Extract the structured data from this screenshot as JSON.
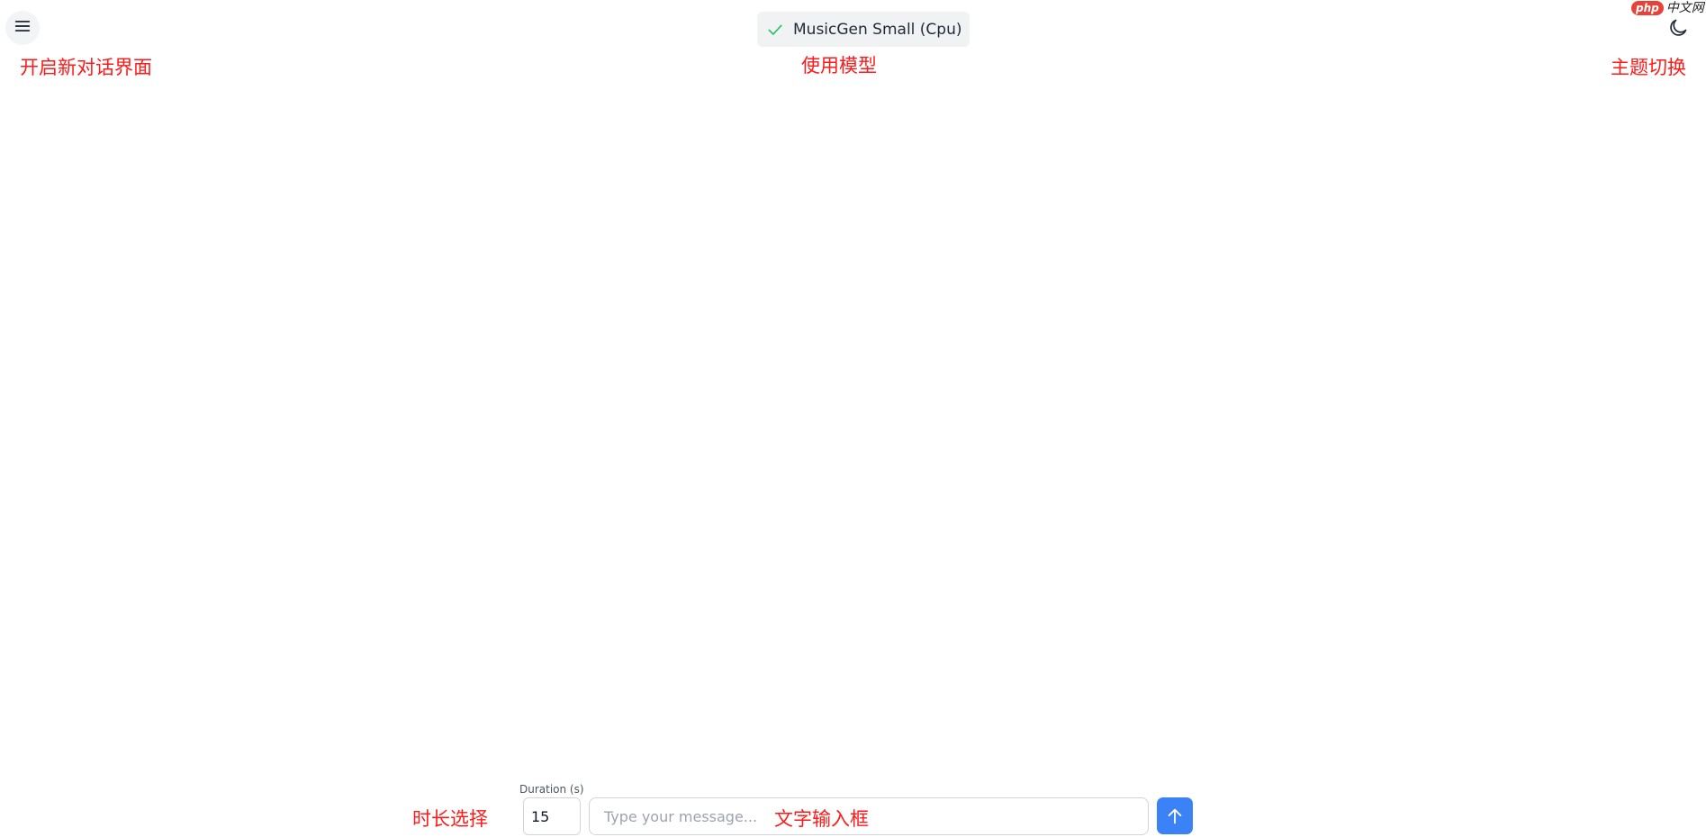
{
  "header": {
    "menu_icon": "hamburger-menu-icon",
    "model_badge": {
      "label": "MusicGen Small (Cpu)",
      "icon": "check-icon",
      "icon_color": "#22c55e"
    },
    "theme_toggle_icon": "moon-icon"
  },
  "watermark": {
    "logo": "php",
    "text": "中文网",
    "color": "#e8413a"
  },
  "annotations": {
    "new_chat": "开启新对话界面",
    "model": "使用模型",
    "theme": "主题切换",
    "duration": "时长选择",
    "text_input": "文字输入框",
    "color": "#ff1a1a"
  },
  "composer": {
    "duration_label": "Duration (s)",
    "duration_value": "15",
    "message_placeholder": "Type your message...",
    "message_value": "",
    "send_icon": "arrow-up-icon",
    "send_color": "#3b82f6"
  }
}
